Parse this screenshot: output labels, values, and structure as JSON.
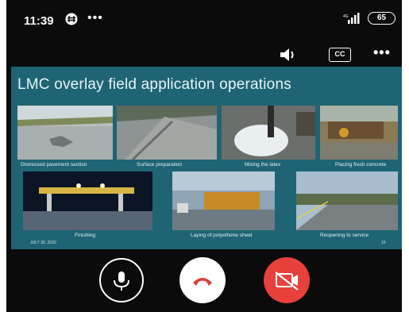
{
  "status_bar": {
    "time": "11:39",
    "battery": "65"
  },
  "call_controls": {
    "cc_label": "CC"
  },
  "slide": {
    "title": "LMC overlay field application operations",
    "photos": [
      {
        "caption": "Distressed pavement section"
      },
      {
        "caption": "Surface preparation"
      },
      {
        "caption": "Mixing the latex"
      },
      {
        "caption": "Placing fresh concrete"
      },
      {
        "caption": "Finishing"
      },
      {
        "caption": "Laying of polyethene sheet"
      },
      {
        "caption": "Reopening to service"
      }
    ],
    "footer_date": "JULY 30, 2020",
    "footer_page": "10"
  },
  "colors": {
    "slide_bg": "#1e6474",
    "end_call": "#e0403a",
    "camera_off": "#e8403b"
  },
  "icons": [
    "keypad-icon",
    "signal-icon",
    "speaker-icon",
    "closed-caption-icon",
    "more-options-icon",
    "microphone-icon",
    "end-call-icon",
    "camera-off-icon"
  ]
}
